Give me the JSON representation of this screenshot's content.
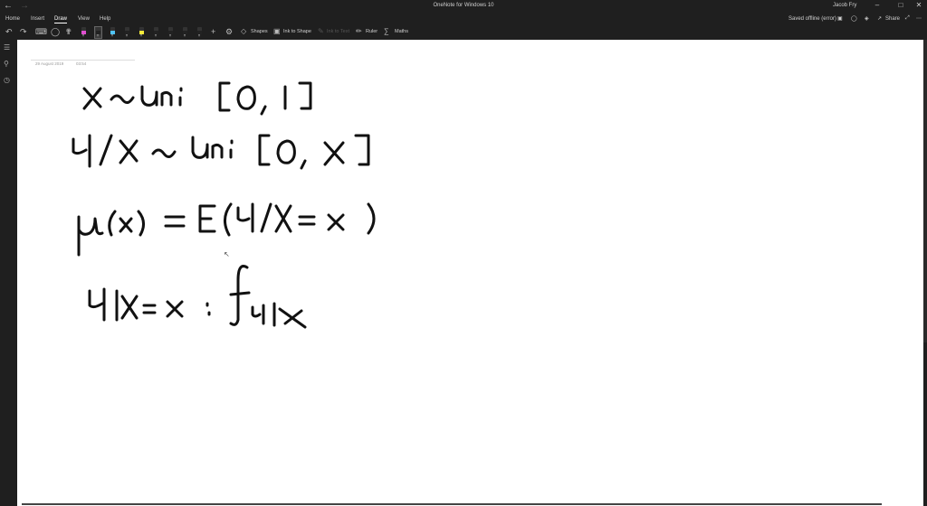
{
  "app": {
    "title": "OneNote for Windows 10",
    "user": "Jacob Fry"
  },
  "menu": {
    "tabs": [
      "Home",
      "Insert",
      "Draw",
      "View",
      "Help"
    ],
    "active": "Draw",
    "status": "Saved offline (error)",
    "share_label": "Share"
  },
  "toolbar": {
    "shapes_label": "Shapes",
    "ink_to_shape_label": "Ink to Shape",
    "ink_to_text_label": "Ink to Text",
    "ruler_label": "Ruler",
    "maths_label": "Maths",
    "pen_colors": [
      "#e04fd0",
      "#222222",
      "#4fc3f7",
      "#222222",
      "#f5ea3a",
      "#222222",
      "#222222",
      "#222222",
      "#222222",
      "#222222"
    ]
  },
  "page": {
    "date": "29 August 2019",
    "time": "03:54"
  }
}
